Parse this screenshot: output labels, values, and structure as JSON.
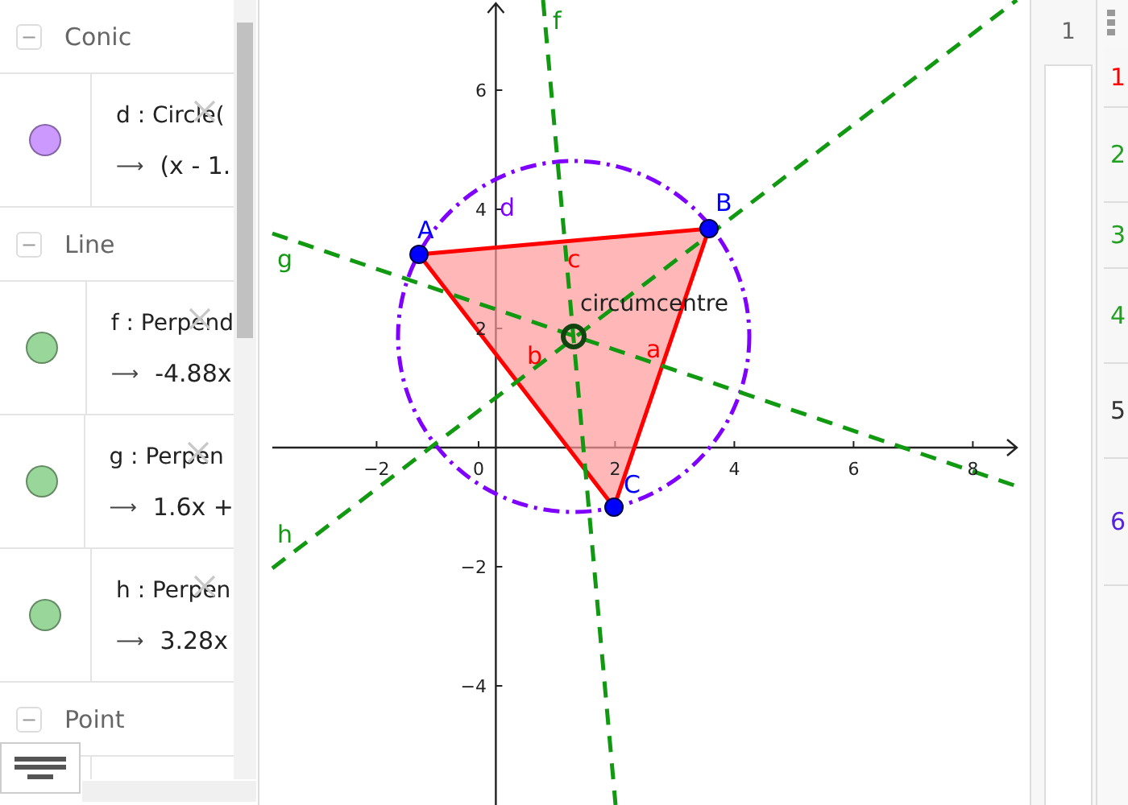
{
  "algebra": {
    "groups": [
      {
        "title": "Conic",
        "collapse": "−",
        "items": [
          {
            "color": "#cc99ff",
            "definition": "d : Circle(",
            "arrow": "⟶",
            "value": "(x - 1."
          }
        ]
      },
      {
        "title": "Line",
        "collapse": "−",
        "items": [
          {
            "color": "#99d699",
            "definition": "f : Perpend",
            "arrow": "⟶",
            "value": "-4.88x"
          },
          {
            "color": "#99d699",
            "definition": "g : Perpen",
            "arrow": "⟶",
            "value": "1.6x +"
          },
          {
            "color": "#99d699",
            "definition": "h : Perpen",
            "arrow": "⟶",
            "value": "3.28x"
          }
        ]
      },
      {
        "title": "Point",
        "collapse": "−"
      }
    ]
  },
  "graphics": {
    "x_ticks": [
      "−2",
      "0",
      "2",
      "4",
      "6",
      "8"
    ],
    "y_ticks": [
      "6",
      "4",
      "2",
      "−2",
      "−4"
    ],
    "points": [
      "A",
      "B",
      "C"
    ],
    "lines": [
      "f",
      "g",
      "h"
    ],
    "circle": "d",
    "segments": [
      "a",
      "b",
      "c"
    ],
    "center_caption": "circumcentre"
  },
  "spreadsheet": {
    "column_header": "1"
  },
  "protocol": {
    "steps": [
      {
        "number": "1",
        "color": "#ff0000"
      },
      {
        "number": "2",
        "color": "#22a022"
      },
      {
        "number": "3",
        "color": "#22a022"
      },
      {
        "number": "4",
        "color": "#22a022"
      },
      {
        "number": "5",
        "color": "#333333"
      },
      {
        "number": "6",
        "color": "#5522dd"
      }
    ]
  }
}
